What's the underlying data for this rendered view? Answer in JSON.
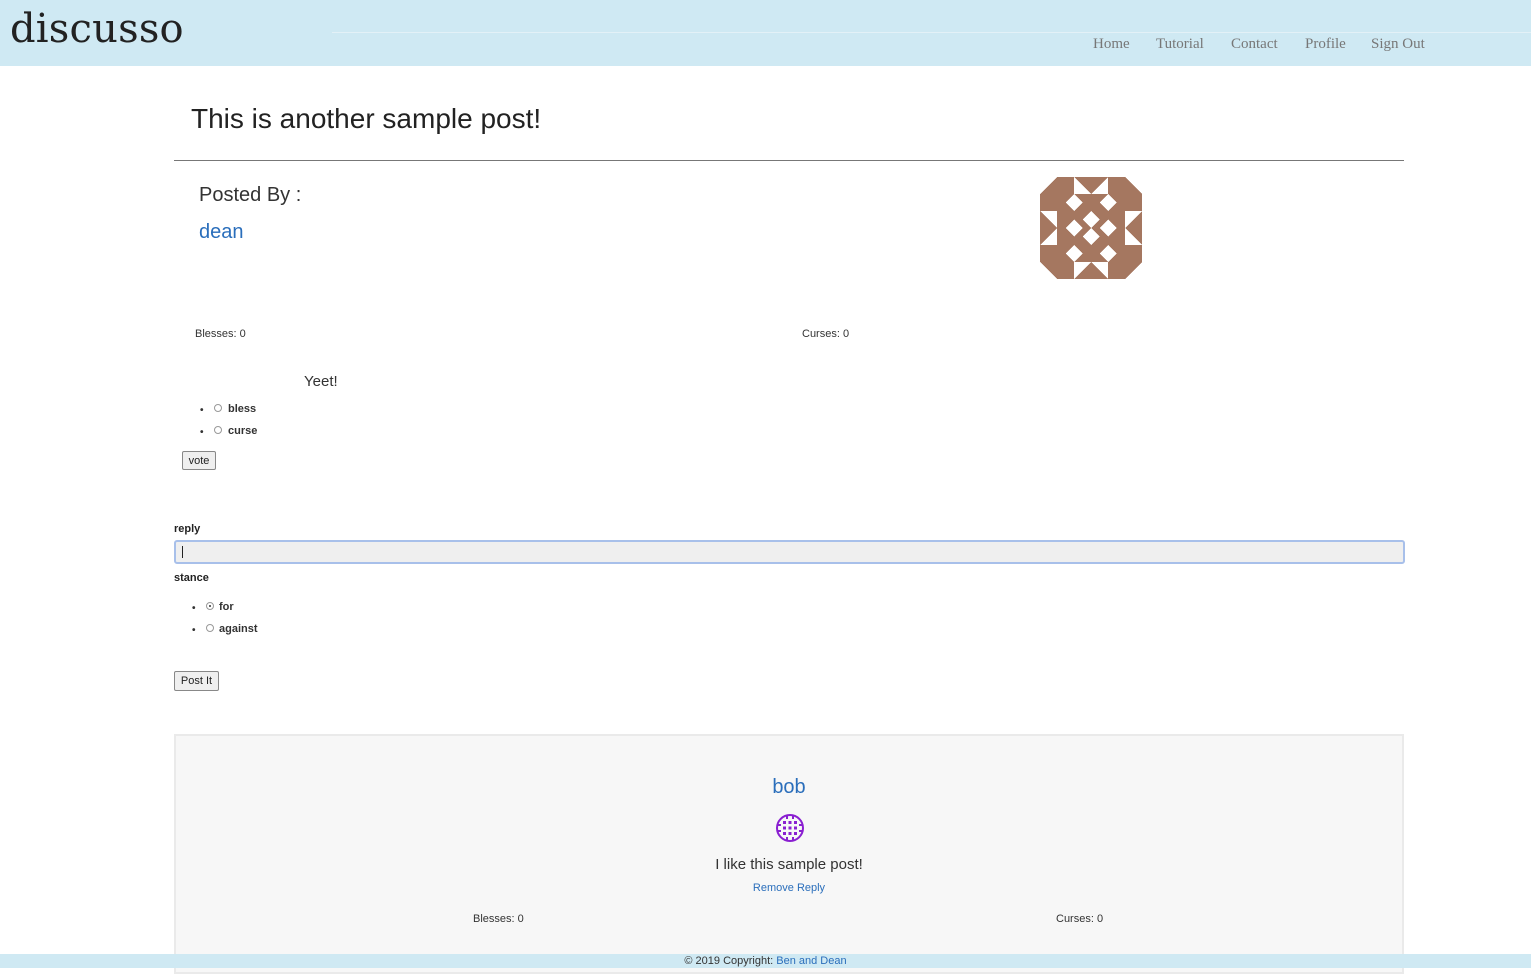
{
  "brand": "discusso",
  "nav": {
    "home": "Home",
    "tutorial": "Tutorial",
    "contact": "Contact",
    "profile": "Profile",
    "sign_out": "Sign Out"
  },
  "post": {
    "title": "This is another sample post!",
    "posted_by_label": "Posted By :",
    "author": "dean",
    "blesses": "Blesses: 0",
    "curses": "Curses: 0",
    "body": "Yeet!",
    "vote_options": [
      "bless",
      "curse"
    ],
    "vote_button": "vote",
    "avatar_color": "#a57760"
  },
  "reply_form": {
    "reply_label": "reply",
    "reply_value": "",
    "stance_label": "stance",
    "stance_options": [
      "for",
      "against"
    ],
    "stance_selected": "for",
    "submit_button": "Post It"
  },
  "replies": [
    {
      "author": "bob",
      "text": "I like this sample post!",
      "remove_label": "Remove Reply",
      "blesses": "Blesses: 0",
      "curses": "Curses: 0",
      "avatar_color": "#8a1fd1"
    }
  ],
  "footer": {
    "copyright": "© 2019 Copyright:",
    "link": "Ben and Dean"
  }
}
